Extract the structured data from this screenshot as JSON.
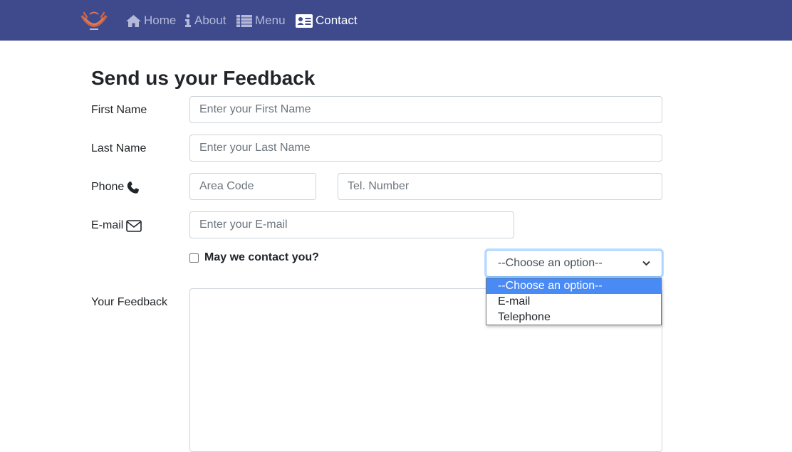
{
  "nav": {
    "logo_icon": "crescent-logo-icon",
    "items": [
      {
        "label": "Home",
        "icon": "home-icon",
        "active": false
      },
      {
        "label": "About",
        "icon": "info-icon",
        "active": false
      },
      {
        "label": "Menu",
        "icon": "list-icon",
        "active": false
      },
      {
        "label": "Contact",
        "icon": "address-card-icon",
        "active": true
      }
    ]
  },
  "form": {
    "title": "Send us your Feedback",
    "first_name": {
      "label": "First Name",
      "placeholder": "Enter your First Name",
      "value": ""
    },
    "last_name": {
      "label": "Last Name",
      "placeholder": "Enter your Last Name",
      "value": ""
    },
    "phone": {
      "label": "Phone",
      "icon": "phone-icon",
      "area_placeholder": "Area Code",
      "number_placeholder": "Tel. Number"
    },
    "email": {
      "label": "E-mail",
      "icon": "envelope-icon",
      "placeholder": "Enter your E-mail",
      "value": ""
    },
    "contact_checkbox": {
      "label": "May we contact you?",
      "checked": false
    },
    "contact_select": {
      "selected": "--Choose an option--",
      "options": [
        "--Choose an option--",
        "E-mail",
        "Telephone"
      ],
      "open": true
    },
    "feedback": {
      "label": "Your Feedback",
      "value": ""
    }
  },
  "colors": {
    "navbar": "#3e4a8c",
    "nav_text": "#b4b9d9",
    "nav_active": "#ffffff",
    "option_highlight": "#4a8af4",
    "focus_border": "#80bdff"
  }
}
